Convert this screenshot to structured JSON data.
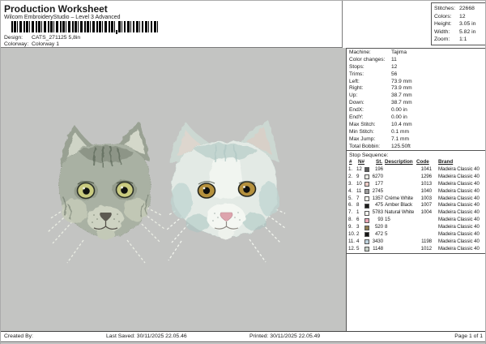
{
  "header": {
    "title": "Production Worksheet",
    "subtitle": "Wilcom EmbroideryStudio – Level 3 Advanced",
    "design": {
      "label": "Design:",
      "value": "CATS_271125 5,8in"
    },
    "colorway": {
      "label": "Colorway:",
      "value": "Colorway 1"
    }
  },
  "summary": {
    "rows": [
      {
        "label": "Stitches:",
        "value": "22668"
      },
      {
        "label": "Colors:",
        "value": "12"
      },
      {
        "label": "Height:",
        "value": "3.05 in"
      },
      {
        "label": "Width:",
        "value": "5.82 in"
      },
      {
        "label": "Zoom:",
        "value": "1:1"
      }
    ]
  },
  "machine": {
    "rows": [
      {
        "label": "Machine:",
        "value": "Tajima"
      },
      {
        "label": "Color changes:",
        "value": "11"
      },
      {
        "label": "Stops:",
        "value": "12"
      },
      {
        "label": "Trims:",
        "value": "56"
      },
      {
        "label": "Left:",
        "value": "73.9 mm"
      },
      {
        "label": "Right:",
        "value": "73.9 mm"
      },
      {
        "label": "Up:",
        "value": "38.7 mm"
      },
      {
        "label": "Down:",
        "value": "38.7 mm"
      },
      {
        "label": "EndX:",
        "value": "0.00 in"
      },
      {
        "label": "EndY:",
        "value": "0.00 in"
      },
      {
        "label": "Max Stitch:",
        "value": "10.4 mm"
      },
      {
        "label": "Min Stitch:",
        "value": "0.1 mm"
      },
      {
        "label": "Max Jump:",
        "value": "7.1 mm"
      },
      {
        "label": "Total Bobbin:",
        "value": "125.50ft"
      }
    ]
  },
  "stop_sequence": {
    "title": "Stop Sequence:",
    "columns": {
      "num": "#",
      "needle": "N#",
      "stitches": "St.",
      "description": "Description",
      "code": "Code",
      "brand": "Brand"
    },
    "rows": [
      {
        "num": "1.",
        "needle": "12",
        "swatch": "#5a5a5a",
        "st": "196",
        "desc": "",
        "code": "1041",
        "brand": "Madeira Classic 40"
      },
      {
        "num": "2.",
        "needle": "9",
        "swatch": "#e9e9e3",
        "st": "6270",
        "desc": "",
        "code": "1296",
        "brand": "Madeira Classic 40"
      },
      {
        "num": "3.",
        "needle": "10",
        "swatch": "#eccdc7",
        "st": "177",
        "desc": "",
        "code": "1013",
        "brand": "Madeira Classic 40"
      },
      {
        "num": "4.",
        "needle": "11",
        "swatch": "#9c9c9c",
        "st": "2745",
        "desc": "",
        "code": "1040",
        "brand": "Madeira Classic 40"
      },
      {
        "num": "5.",
        "needle": "7",
        "swatch": "#f4f3ec",
        "st": "1357",
        "desc": "Créme White",
        "code": "1003",
        "brand": "Madeira Classic 40"
      },
      {
        "num": "6.",
        "needle": "8",
        "swatch": "#1c1c1c",
        "st": "475",
        "desc": "Amber Black",
        "code": "1007",
        "brand": "Madeira Classic 40"
      },
      {
        "num": "7.",
        "needle": "1",
        "swatch": "#f6f5f0",
        "st": "5783",
        "desc": "Natural White",
        "code": "1004",
        "brand": "Madeira Classic 40"
      },
      {
        "num": "8.",
        "needle": "6",
        "swatch": "#eba6b6",
        "st": "93",
        "desc": "15",
        "code": "",
        "brand": "Madeira Classic 40"
      },
      {
        "num": "9.",
        "needle": "3",
        "swatch": "#8f7c50",
        "st": "520",
        "desc": "8",
        "code": "",
        "brand": "Madeira Classic 40"
      },
      {
        "num": "10.",
        "needle": "2",
        "swatch": "#161616",
        "st": "472",
        "desc": "5",
        "code": "",
        "brand": "Madeira Classic 40"
      },
      {
        "num": "11.",
        "needle": "4",
        "swatch": "#bed2dc",
        "st": "3430",
        "desc": "",
        "code": "1198",
        "brand": "Madeira Classic 40"
      },
      {
        "num": "12.",
        "needle": "5",
        "swatch": "#c7d0c8",
        "st": "1148",
        "desc": "",
        "code": "1012",
        "brand": "Madeira Classic 40"
      }
    ]
  },
  "footer": {
    "created_by": "Created By:",
    "last_saved": "Last Saved: 30/11/2025 22.05.46",
    "printed": "Printed: 30/11/2025 22.05.49",
    "page": "Page 1 of 1"
  },
  "canvas": {
    "background": "#c3c4c2"
  }
}
